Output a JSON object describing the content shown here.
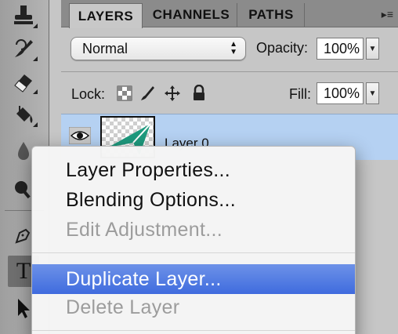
{
  "panel": {
    "tabs": [
      "LAYERS",
      "CHANNELS",
      "PATHS"
    ],
    "menu_icon": "panel-menu-icon",
    "blend_mode": "Normal",
    "opacity_label": "Opacity:",
    "opacity_value": "100%",
    "lock_label": "Lock:",
    "fill_label": "Fill:",
    "fill_value": "100%"
  },
  "layer": {
    "name": "Layer 0",
    "visible": true
  },
  "context_menu": {
    "items": [
      {
        "label": "Layer Properties...",
        "state": "enabled"
      },
      {
        "label": "Blending Options...",
        "state": "enabled"
      },
      {
        "label": "Edit Adjustment...",
        "state": "disabled"
      },
      {
        "label": "Duplicate Layer...",
        "state": "highlighted"
      },
      {
        "label": "Delete Layer",
        "state": "disabled"
      }
    ]
  },
  "tools": [
    "stamp-tool-icon",
    "history-brush-icon",
    "eraser-icon",
    "paint-bucket-icon",
    "blur-icon",
    "dodge-icon",
    "pen-tool-icon",
    "type-tool-icon",
    "path-selection-icon"
  ],
  "colors": {
    "selection_blue": "#3f6bde",
    "layer_selected_bg": "#b5d1f2",
    "thumb_shape": "#1e9a7e"
  }
}
